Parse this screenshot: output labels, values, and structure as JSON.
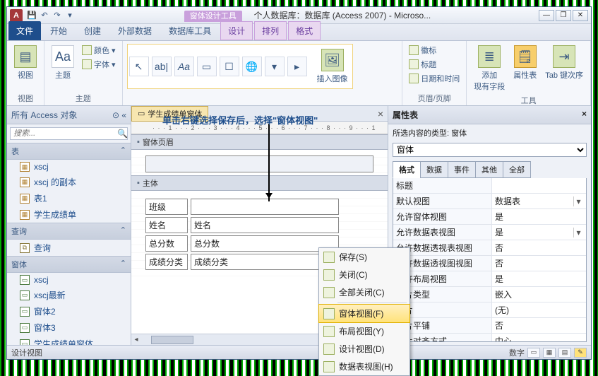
{
  "titlebar": {
    "context_tool_label": "窗体设计工具",
    "app_title": "个人数据库：数据库 (Access 2007) - Microso..."
  },
  "tabs": {
    "file": "文件",
    "items": [
      "开始",
      "创建",
      "外部数据",
      "数据库工具",
      "设计",
      "排列",
      "格式"
    ],
    "active_index": 4
  },
  "ribbon": {
    "views_group": "视图",
    "views_btn": "视图",
    "themes_group": "主题",
    "themes_btn": "主题",
    "colors_btn": "颜色",
    "fonts_btn": "字体",
    "insert_image_btn": "插入图像",
    "annotation_text": "单击右键选择保存后，选择\"窗体视图\"",
    "header_footer_group": "页眉/页脚",
    "logo_btn": "徽标",
    "title_btn": "标题",
    "datetime_btn": "日期和时间",
    "tools_group": "工具",
    "add_fields_btn": "添加\n现有字段",
    "prop_sheet_btn": "属性表",
    "tab_order_btn": "Tab 键次序"
  },
  "nav": {
    "header": "所有 Access 对象",
    "search_placeholder": "搜索...",
    "sections": {
      "tables": "表",
      "queries": "查询",
      "forms": "窗体"
    },
    "tables": [
      "xscj",
      "xscj 的副本",
      "表1",
      "学生成绩单"
    ],
    "queries": [
      "查询"
    ],
    "forms": [
      "xscj",
      "xscj最新",
      "窗体2",
      "窗体3",
      "学生成绩单窗体"
    ]
  },
  "document": {
    "tab_label": "学生成绩单窗体",
    "ruler_text": "· · · 1 · · · 2 · · · 3 · · · 4 · · · 5 · · · 6 · · · 7 · · · 8 · · · 9 · · · 1",
    "section_header": "窗体页眉",
    "section_detail": "主体",
    "fields": [
      {
        "label": "班级",
        "box": ""
      },
      {
        "label": "姓名",
        "box": "姓名"
      },
      {
        "label": "总分数",
        "box": "总分数"
      },
      {
        "label": "成绩分类",
        "box": "成绩分类"
      }
    ]
  },
  "context_menu": {
    "items": [
      {
        "label": "保存(S)",
        "hover": false
      },
      {
        "label": "关闭(C)",
        "hover": false
      },
      {
        "label": "全部关闭(C)",
        "hover": false
      },
      {
        "sep": true
      },
      {
        "label": "窗体视图(F)",
        "hover": true
      },
      {
        "label": "布局视图(Y)",
        "hover": false
      },
      {
        "label": "设计视图(D)",
        "hover": false
      },
      {
        "label": "数据表视图(H)",
        "hover": false
      }
    ]
  },
  "prop": {
    "title": "属性表",
    "subtitle": "所选内容的类型: 窗体",
    "selector_value": "窗体",
    "tabs": [
      "格式",
      "数据",
      "事件",
      "其他",
      "全部"
    ],
    "active_tab": 0,
    "rows": [
      {
        "name": "标题",
        "val": ""
      },
      {
        "name": "默认视图",
        "val": "数据表",
        "dd": true
      },
      {
        "name": "允许窗体视图",
        "val": "是"
      },
      {
        "name": "允许数据表视图",
        "val": "是",
        "dd": true
      },
      {
        "name": "允许数据透视表视图",
        "val": "否"
      },
      {
        "name": "允许数据透视图视图",
        "val": "否"
      },
      {
        "name": "允许布局视图",
        "val": "是"
      },
      {
        "name": "图片类型",
        "val": "嵌入"
      },
      {
        "name": "图片",
        "val": "(无)"
      },
      {
        "name": "图片平铺",
        "val": "否"
      },
      {
        "name": "图片对齐方式",
        "val": "中心"
      }
    ]
  },
  "status": {
    "left": "设计视图",
    "right_label": "数字"
  }
}
